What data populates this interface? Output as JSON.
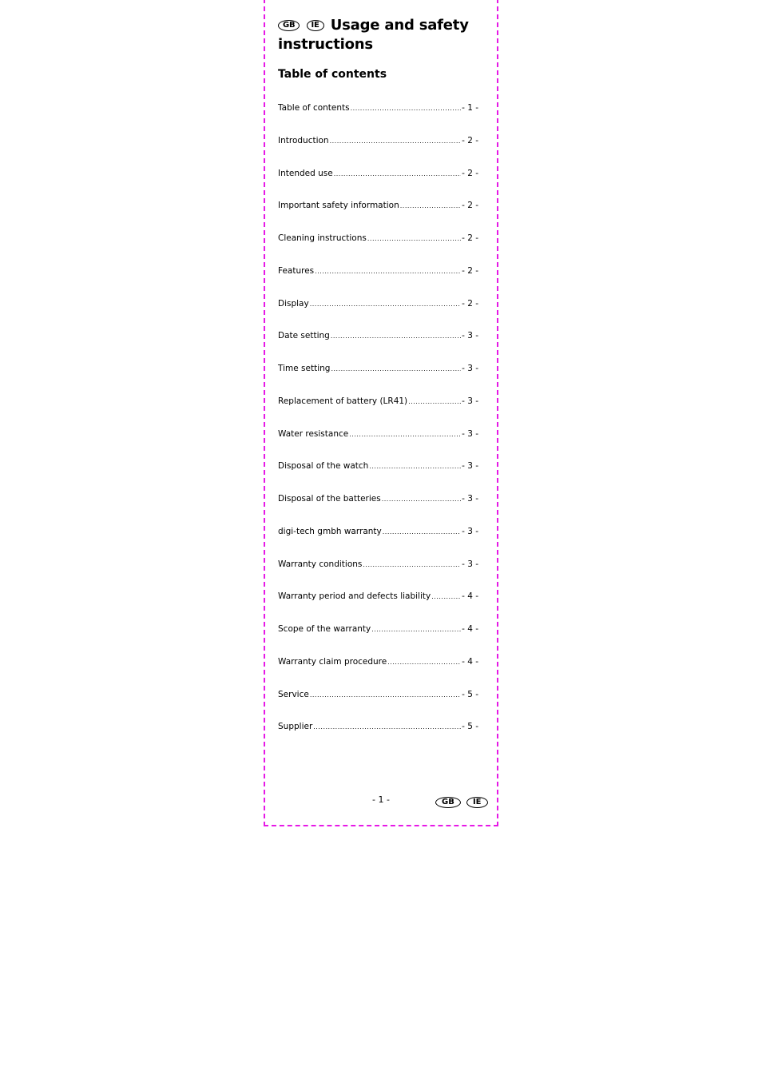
{
  "header": {
    "badges": [
      "GB",
      "IE"
    ],
    "title": "Usage and safety instructions"
  },
  "toc": {
    "heading": "Table of contents",
    "entries": [
      {
        "label": "Table of contents",
        "page": "- 1 -"
      },
      {
        "label": "Introduction",
        "page": "- 2 -"
      },
      {
        "label": "Intended use",
        "page": "- 2 -"
      },
      {
        "label": "Important safety information",
        "page": "- 2 -"
      },
      {
        "label": "Cleaning instructions",
        "page": "- 2 -"
      },
      {
        "label": "Features",
        "page": "- 2 -"
      },
      {
        "label": "Display",
        "page": "- 2 -"
      },
      {
        "label": "Date setting",
        "page": "- 3 -"
      },
      {
        "label": "Time setting",
        "page": "- 3 -"
      },
      {
        "label": "Replacement of battery (LR41)",
        "page": "- 3 -"
      },
      {
        "label": "Water resistance",
        "page": "- 3 -"
      },
      {
        "label": "Disposal of the watch",
        "page": "- 3 -"
      },
      {
        "label": "Disposal of the batteries",
        "page": "- 3 -"
      },
      {
        "label": "digi-tech gmbh warranty",
        "page": "- 3 -"
      },
      {
        "label": "Warranty conditions",
        "page": "- 3 -"
      },
      {
        "label": "Warranty period and defects liability",
        "page": "- 4 -"
      },
      {
        "label": "Scope of the warranty",
        "page": "- 4 -"
      },
      {
        "label": "Warranty claim procedure",
        "page": "- 4 -"
      },
      {
        "label": "Service",
        "page": "- 5 -"
      },
      {
        "label": "Supplier",
        "page": "- 5 -"
      }
    ]
  },
  "footer": {
    "page_number": "- 1 -",
    "badges": [
      "GB",
      "IE"
    ]
  },
  "colors": {
    "page_border": "#e619e6"
  }
}
